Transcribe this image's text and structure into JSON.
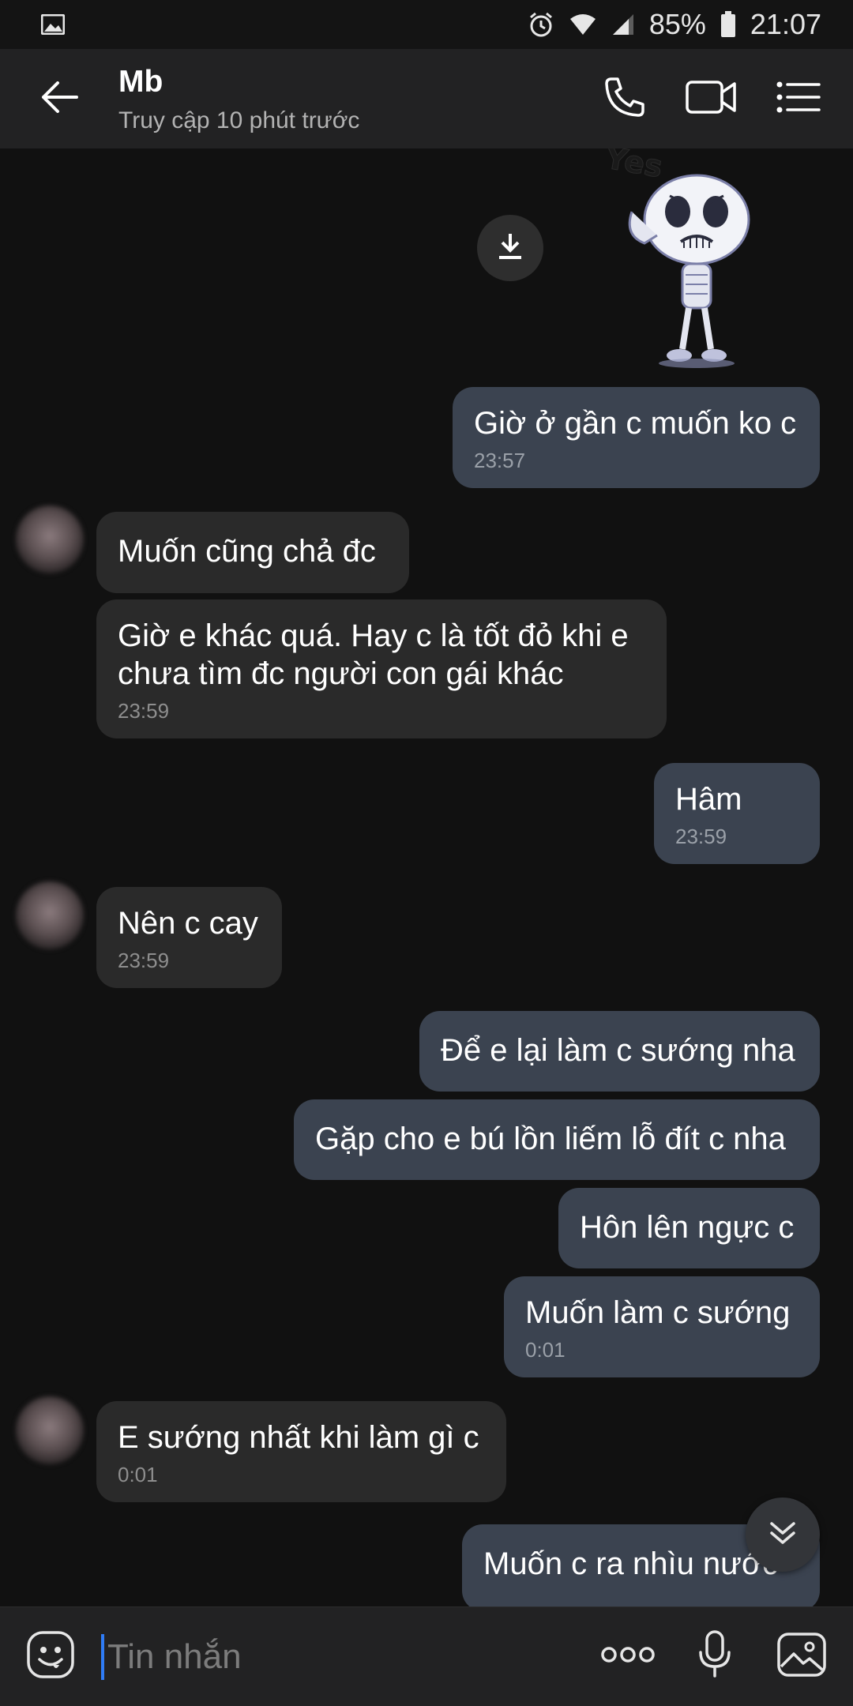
{
  "status_bar": {
    "battery": "85%",
    "time": "21:07",
    "left_icon": "image-icon",
    "right_icons": [
      "alarm-icon",
      "wifi-icon",
      "signal-icon",
      "battery-icon"
    ]
  },
  "header": {
    "contact_name": "Mb",
    "contact_status": "Truy cập 10 phút trước",
    "icons": [
      "back-arrow-icon",
      "phone-icon",
      "video-call-icon",
      "menu-list-icon"
    ]
  },
  "chat": {
    "sticker": {
      "icon": "crying-skeleton-sticker",
      "lettering": "Yes"
    },
    "messages": [
      {
        "dir": "out",
        "text": "Giờ ở gần c muốn ko c",
        "time": "23:57"
      },
      {
        "dir": "in",
        "text": "Muốn cũng chả đc",
        "time": ""
      },
      {
        "dir": "in",
        "text": "Giờ e khác quá. Hay c là tốt đỏ khi e chưa tìm đc người con gái khác",
        "time": "23:59"
      },
      {
        "dir": "out",
        "text": "Hâm",
        "time": "23:59"
      },
      {
        "dir": "in",
        "text": "Nên c cay",
        "time": "23:59"
      },
      {
        "dir": "out",
        "text": "Để e lại làm c sướng nha",
        "time": ""
      },
      {
        "dir": "out",
        "text": "Gặp cho e bú lồn liếm lỗ đít c nha",
        "time": ""
      },
      {
        "dir": "out",
        "text": "Hôn lên ngực c",
        "time": ""
      },
      {
        "dir": "out",
        "text": "Muốn làm c sướng",
        "time": "0:01"
      },
      {
        "dir": "in",
        "text": "E sướng nhất khi làm gì c",
        "time": "0:01"
      },
      {
        "dir": "out",
        "text": "Muốn c ra nhìu nước",
        "time": ""
      }
    ]
  },
  "input_bar": {
    "placeholder": "Tin nhắn",
    "icons": [
      "emoji-icon",
      "more-dots-icon",
      "microphone-icon",
      "gallery-icon"
    ]
  },
  "colors": {
    "background": "#111111",
    "header": "#222223",
    "outgoing_bubble": "#3b4350",
    "incoming_bubble": "#2a2a2a",
    "caret": "#2f7cf6"
  }
}
